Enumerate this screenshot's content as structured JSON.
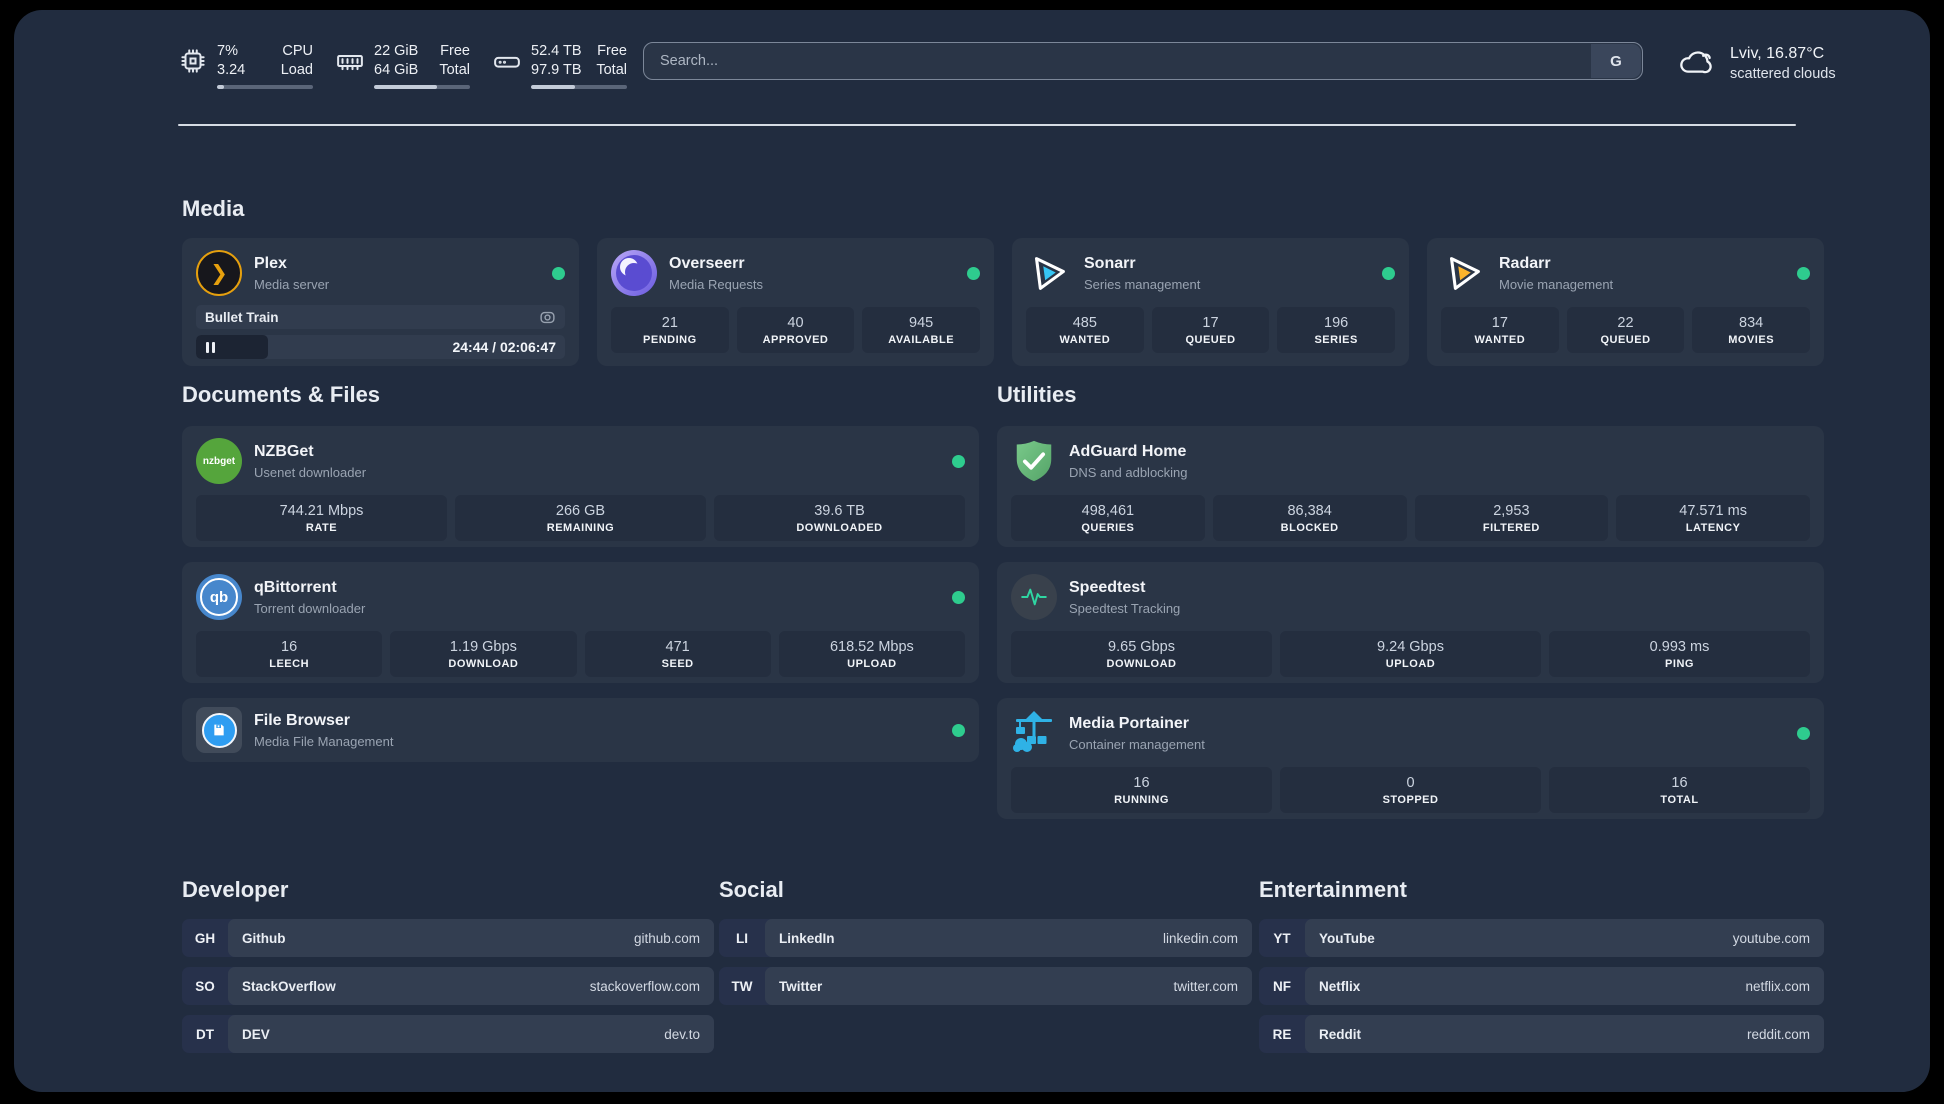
{
  "colors": {
    "status_online": "#2ecc8e",
    "accent_blue": "#2fb2e6",
    "panel_bg": "#212c3f"
  },
  "header": {
    "cpu": {
      "v1": "7%",
      "l1": "CPU",
      "v2": "3.24",
      "l2": "Load",
      "progress": 7
    },
    "ram": {
      "v1": "22 GiB",
      "l1": "Free",
      "v2": "64 GiB",
      "l2": "Total",
      "progress": 66
    },
    "disk": {
      "v1": "52.4 TB",
      "l1": "Free",
      "v2": "97.9 TB",
      "l2": "Total",
      "progress": 46
    },
    "search": {
      "placeholder": "Search...",
      "engine": "G"
    },
    "weather": {
      "location": "Lviv, 16.87°C",
      "condition": "scattered clouds"
    }
  },
  "sections": {
    "media": {
      "title": "Media",
      "apps": [
        {
          "name": "Plex",
          "subtitle": "Media server",
          "online": true,
          "now_playing": {
            "title": "Bullet Train",
            "time": "24:44 / 02:06:47",
            "progress": 19.5,
            "state": "paused"
          }
        },
        {
          "name": "Overseerr",
          "subtitle": "Media Requests",
          "online": true,
          "stats": [
            {
              "value": "21",
              "label": "PENDING"
            },
            {
              "value": "40",
              "label": "APPROVED"
            },
            {
              "value": "945",
              "label": "AVAILABLE"
            }
          ]
        },
        {
          "name": "Sonarr",
          "subtitle": "Series management",
          "online": true,
          "stats": [
            {
              "value": "485",
              "label": "WANTED"
            },
            {
              "value": "17",
              "label": "QUEUED"
            },
            {
              "value": "196",
              "label": "SERIES"
            }
          ]
        },
        {
          "name": "Radarr",
          "subtitle": "Movie management",
          "online": true,
          "stats": [
            {
              "value": "17",
              "label": "WANTED"
            },
            {
              "value": "22",
              "label": "QUEUED"
            },
            {
              "value": "834",
              "label": "MOVIES"
            }
          ]
        }
      ]
    },
    "documents": {
      "title": "Documents & Files",
      "apps": [
        {
          "name": "NZBGet",
          "subtitle": "Usenet downloader",
          "online": true,
          "stats": [
            {
              "value": "744.21 Mbps",
              "label": "RATE"
            },
            {
              "value": "266 GB",
              "label": "REMAINING"
            },
            {
              "value": "39.6 TB",
              "label": "DOWNLOADED"
            }
          ]
        },
        {
          "name": "qBittorrent",
          "subtitle": "Torrent downloader",
          "online": true,
          "stats": [
            {
              "value": "16",
              "label": "LEECH"
            },
            {
              "value": "1.19 Gbps",
              "label": "DOWNLOAD"
            },
            {
              "value": "471",
              "label": "SEED"
            },
            {
              "value": "618.52 Mbps",
              "label": "UPLOAD"
            }
          ]
        },
        {
          "name": "File Browser",
          "subtitle": "Media File Management",
          "online": true
        }
      ]
    },
    "utilities": {
      "title": "Utilities",
      "apps": [
        {
          "name": "AdGuard Home",
          "subtitle": "DNS and adblocking",
          "stats": [
            {
              "value": "498,461",
              "label": "QUERIES"
            },
            {
              "value": "86,384",
              "label": "BLOCKED"
            },
            {
              "value": "2,953",
              "label": "FILTERED"
            },
            {
              "value": "47.571 ms",
              "label": "LATENCY"
            }
          ]
        },
        {
          "name": "Speedtest",
          "subtitle": "Speedtest Tracking",
          "stats": [
            {
              "value": "9.65 Gbps",
              "label": "DOWNLOAD"
            },
            {
              "value": "9.24 Gbps",
              "label": "UPLOAD"
            },
            {
              "value": "0.993 ms",
              "label": "PING"
            }
          ]
        },
        {
          "name": "Media Portainer",
          "subtitle": "Container management",
          "online": true,
          "stats": [
            {
              "value": "16",
              "label": "RUNNING"
            },
            {
              "value": "0",
              "label": "STOPPED"
            },
            {
              "value": "16",
              "label": "TOTAL"
            }
          ]
        }
      ]
    },
    "developer": {
      "title": "Developer",
      "links": [
        {
          "abbr": "GH",
          "name": "Github",
          "url": "github.com"
        },
        {
          "abbr": "SO",
          "name": "StackOverflow",
          "url": "stackoverflow.com"
        },
        {
          "abbr": "DT",
          "name": "DEV",
          "url": "dev.to"
        }
      ]
    },
    "social": {
      "title": "Social",
      "links": [
        {
          "abbr": "LI",
          "name": "LinkedIn",
          "url": "linkedin.com"
        },
        {
          "abbr": "TW",
          "name": "Twitter",
          "url": "twitter.com"
        }
      ]
    },
    "entertainment": {
      "title": "Entertainment",
      "links": [
        {
          "abbr": "YT",
          "name": "YouTube",
          "url": "youtube.com"
        },
        {
          "abbr": "NF",
          "name": "Netflix",
          "url": "netflix.com"
        },
        {
          "abbr": "RE",
          "name": "Reddit",
          "url": "reddit.com"
        }
      ]
    }
  }
}
